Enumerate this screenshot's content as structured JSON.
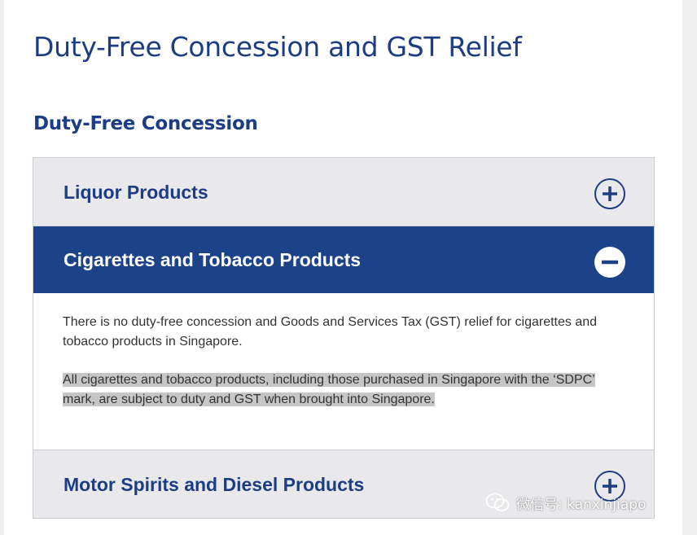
{
  "page": {
    "title": "Duty-Free Concession and GST Relief",
    "section_title": "Duty-Free Concession"
  },
  "accordion": {
    "items": [
      {
        "label": "Liquor Products",
        "state": "collapsed",
        "icon": "plus-circle-icon"
      },
      {
        "label": "Cigarettes and Tobacco Products",
        "state": "expanded",
        "icon": "minus-circle-icon",
        "paragraphs": [
          "There is no duty-free concession and Goods and Services Tax (GST) relief for cigarettes and tobacco products in Singapore.",
          "All cigarettes and tobacco products, including those purchased in Singapore with the ‘SDPC’ mark, are subject to duty and GST when brought into Singapore."
        ]
      },
      {
        "label": "Motor Spirits and Diesel Products",
        "state": "collapsed",
        "icon": "plus-circle-icon"
      }
    ]
  },
  "watermark": {
    "text": "微信号: kanxinjiapo",
    "icon": "wechat-icon"
  },
  "colors": {
    "brand_blue": "#1c428a",
    "title_blue": "#1c3d84",
    "header_gray": "#e9e9ec",
    "highlight": "#c6c6c6"
  }
}
